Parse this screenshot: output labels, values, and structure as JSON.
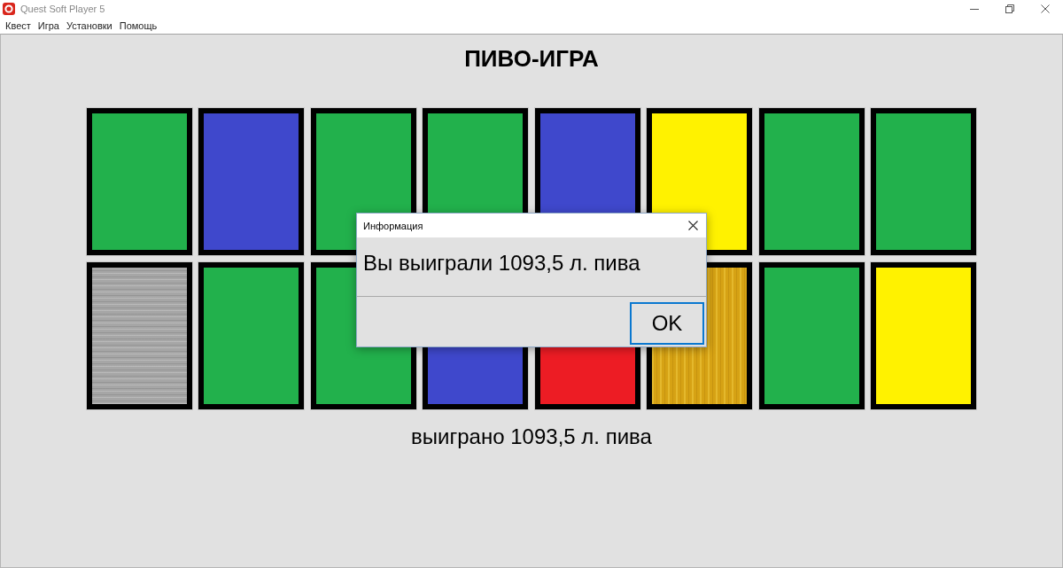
{
  "window": {
    "title": "Quest Soft Player 5"
  },
  "menu": [
    "Квест",
    "Игра",
    "Установки",
    "Помощь"
  ],
  "game": {
    "title": "ПИВО-ИГРА",
    "card_rows": [
      [
        {
          "kind": "plain",
          "color": "#22b14c"
        },
        {
          "kind": "plain",
          "color": "#3f48cc"
        },
        {
          "kind": "plain",
          "color": "#22b14c"
        },
        {
          "kind": "plain",
          "color": "#22b14c"
        },
        {
          "kind": "plain",
          "color": "#3f48cc"
        },
        {
          "kind": "plain",
          "color": "#fff200"
        },
        {
          "kind": "plain",
          "color": "#22b14c"
        },
        {
          "kind": "plain",
          "color": "#22b14c"
        }
      ],
      [
        {
          "kind": "brushed",
          "color": "#a6a6a6"
        },
        {
          "kind": "plain",
          "color": "#22b14c"
        },
        {
          "kind": "plain",
          "color": "#22b14c"
        },
        {
          "kind": "plain",
          "color": "#3f48cc"
        },
        {
          "kind": "plain",
          "color": "#ed1c24"
        },
        {
          "kind": "foil",
          "color": "#d6a214"
        },
        {
          "kind": "plain",
          "color": "#22b14c"
        },
        {
          "kind": "plain",
          "color": "#fff200"
        }
      ]
    ],
    "result": "выиграно 1093,5 л. пива"
  },
  "dialog": {
    "title": "Информация",
    "message": "Вы выиграли 1093,5 л. пива",
    "button": {
      "label": "OK",
      "focused": true
    }
  }
}
